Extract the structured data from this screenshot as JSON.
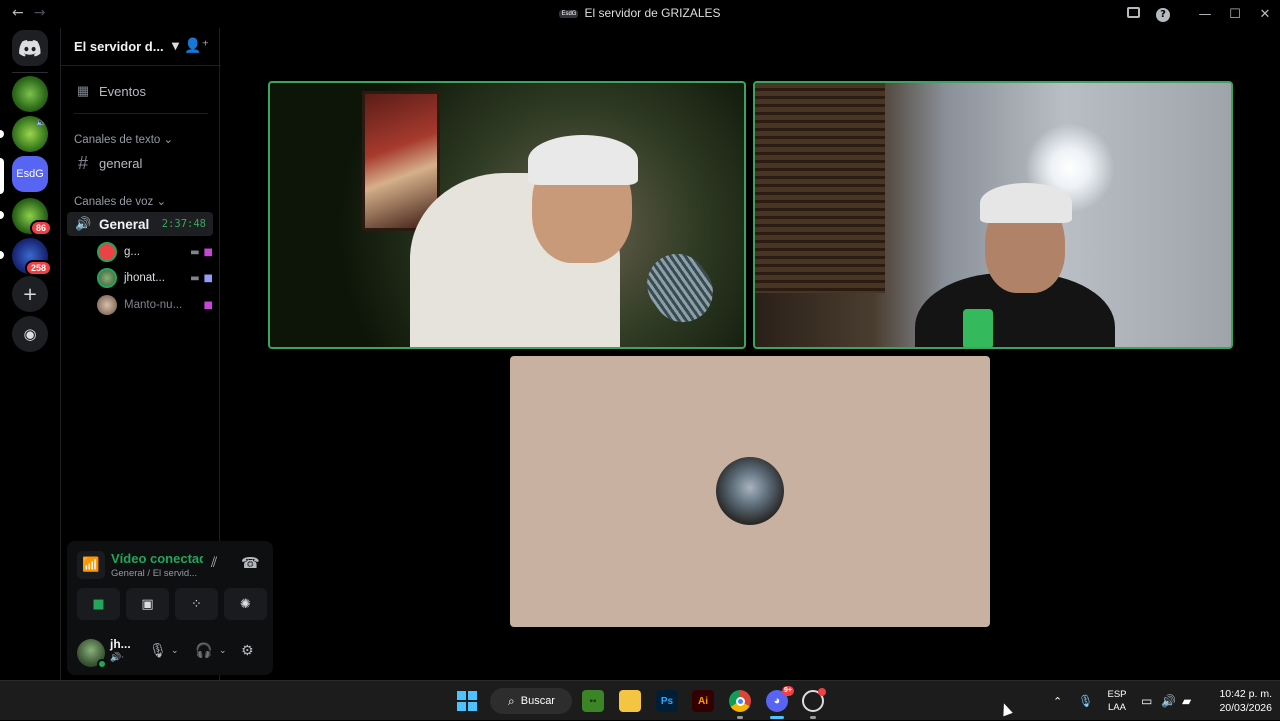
{
  "window": {
    "title": "El servidor de GRIZALES",
    "server_tag": "EsdG",
    "back": "←",
    "forward": "→"
  },
  "rail": {
    "servers": [
      {
        "name": "server-1"
      },
      {
        "name": "server-2"
      },
      {
        "initials": "EsdG",
        "selected": true
      },
      {
        "badge": "86"
      },
      {
        "badge": "258"
      }
    ],
    "add": "+",
    "explore": "◉"
  },
  "sidebar": {
    "server_name": "El servidor d...",
    "events": "Eventos",
    "text_category": "Canales de texto",
    "text_channels": [
      {
        "label": "general"
      }
    ],
    "voice_category": "Canales de voz",
    "voice_channel": {
      "label": "General",
      "timer": "2:37:48"
    },
    "members": [
      {
        "name": "g..."
      },
      {
        "name": "jhonat..."
      },
      {
        "name": "Manto-nu..."
      }
    ]
  },
  "voice_panel": {
    "status": "Vídeo conectado",
    "subtitle": "General / El servid..."
  },
  "user_bar": {
    "name": "jh..."
  },
  "taskbar": {
    "search_label": "Buscar",
    "discord_badge": "9+",
    "lang_top": "ESP",
    "lang_bottom": "LAA",
    "time": "10:42 p. m.",
    "date": "20/03/2026"
  },
  "colors": {
    "accent_green": "#23a55a",
    "speaking_border": "#3ba55d",
    "badge_red": "#f23f43",
    "tile_bg": "#c9b1a1"
  }
}
